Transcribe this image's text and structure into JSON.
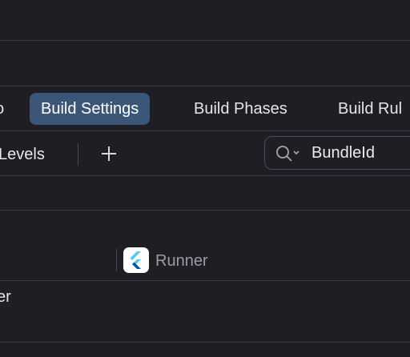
{
  "tabs": [
    {
      "label": "o"
    },
    {
      "label": "Build Settings",
      "selected": true
    },
    {
      "label": "Build Phases"
    },
    {
      "label": "Build Rul"
    }
  ],
  "filter_bar": {
    "levels_label": "Levels",
    "add_icon": "plus-icon",
    "search": {
      "value": "BundleId",
      "icon": "magnifier-chevron-icon"
    }
  },
  "column_header": {
    "target_name": "Runner",
    "target_icon": "flutter-logo-icon"
  },
  "row": {
    "label": "er"
  },
  "colors": {
    "selected_tab": "#3c5678",
    "background": "#1f1e24",
    "flutter_light": "#54c5f8",
    "flutter_dark": "#01579b"
  }
}
